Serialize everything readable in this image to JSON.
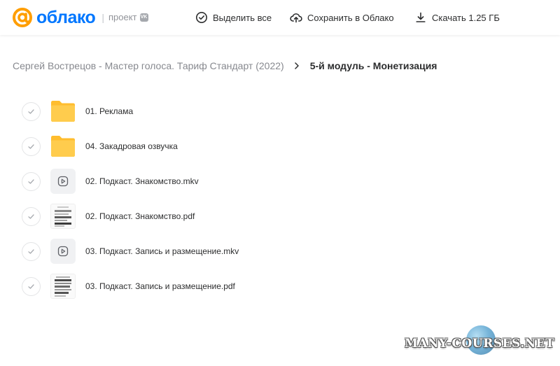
{
  "header": {
    "logo_text": "облако",
    "logo_separator": "|",
    "logo_project": "проект",
    "vk_badge": "VK",
    "select_all_label": "Выделить все",
    "save_label": "Сохранить в Облако",
    "download_label": "Скачать 1.25 ГБ"
  },
  "breadcrumb": {
    "parent": "Сергей Вострецов - Мастер голоса. Тариф Стандарт (2022)",
    "current": "5-й модуль - Монетизация"
  },
  "files": [
    {
      "name": "01. Реклама",
      "type": "folder"
    },
    {
      "name": "04. Закадровая озвучка",
      "type": "folder"
    },
    {
      "name": "02. Подкаст. Знакомство.mkv",
      "type": "video"
    },
    {
      "name": "02. Подкаст. Знакомство.pdf",
      "type": "pdf"
    },
    {
      "name": "03. Подкаст. Запись и размещение.mkv",
      "type": "video"
    },
    {
      "name": "03. Подкаст. Запись и размещение.pdf",
      "type": "pdf"
    }
  ],
  "watermark": {
    "text": "MANY-COURSES.NET"
  },
  "colors": {
    "brand_orange": "#ff9e00",
    "brand_blue": "#0077ff",
    "folder_yellow": "#ffc83a"
  }
}
